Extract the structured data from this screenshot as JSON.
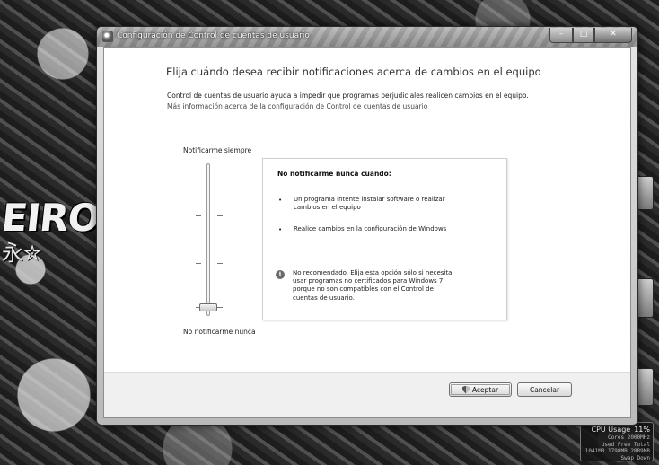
{
  "window": {
    "title": "Configuración de Control de cuentas de usuario",
    "min_glyph": "–",
    "max_glyph": "□",
    "close_glyph": "✕"
  },
  "content": {
    "heading": "Elija cuándo desea recibir notificaciones acerca de cambios en el equipo",
    "description": "Control de cuentas de usuario ayuda a impedir que programas perjudiciales realicen cambios en el equipo.",
    "more_info_link": "Más información acerca de la configuración de Control de cuentas de usuario"
  },
  "slider": {
    "top_label": "Notificarme siempre",
    "bottom_label": "No notificarme nunca",
    "levels": 4,
    "selected_level": 1
  },
  "info_box": {
    "title": "No notificarme nunca cuando:",
    "bullets": [
      "Un programa intente instalar software o realizar\ncambios en el equipo",
      "Realice cambios en la configuración de Windows"
    ],
    "bullet_glyph": "•",
    "warning_icon_glyph": "i",
    "warning": "No recomendado. Elija esta opción sólo si necesita\nusar programas no certificados para Windows 7\nporque no son compatibles con el Control de\ncuentas de usuario."
  },
  "buttons": {
    "ok": "Aceptar",
    "cancel": "Cancelar"
  },
  "desktop": {
    "wallpaper_text": "EIRO",
    "wallpaper_glyph": "永✮",
    "cpu_gadget": {
      "title": "CPU Usage",
      "percent": "11%",
      "rows": [
        "Cores  2000MHz",
        "Used  Free  Total",
        "1041MB 1798MB 2889MB",
        "Swap    Down"
      ]
    }
  },
  "colors": {
    "dialog_background": "#ffffff",
    "footer_background": "#f0f0f0",
    "link": "#4a4a4a",
    "titlebar": "#9a9a9a"
  }
}
